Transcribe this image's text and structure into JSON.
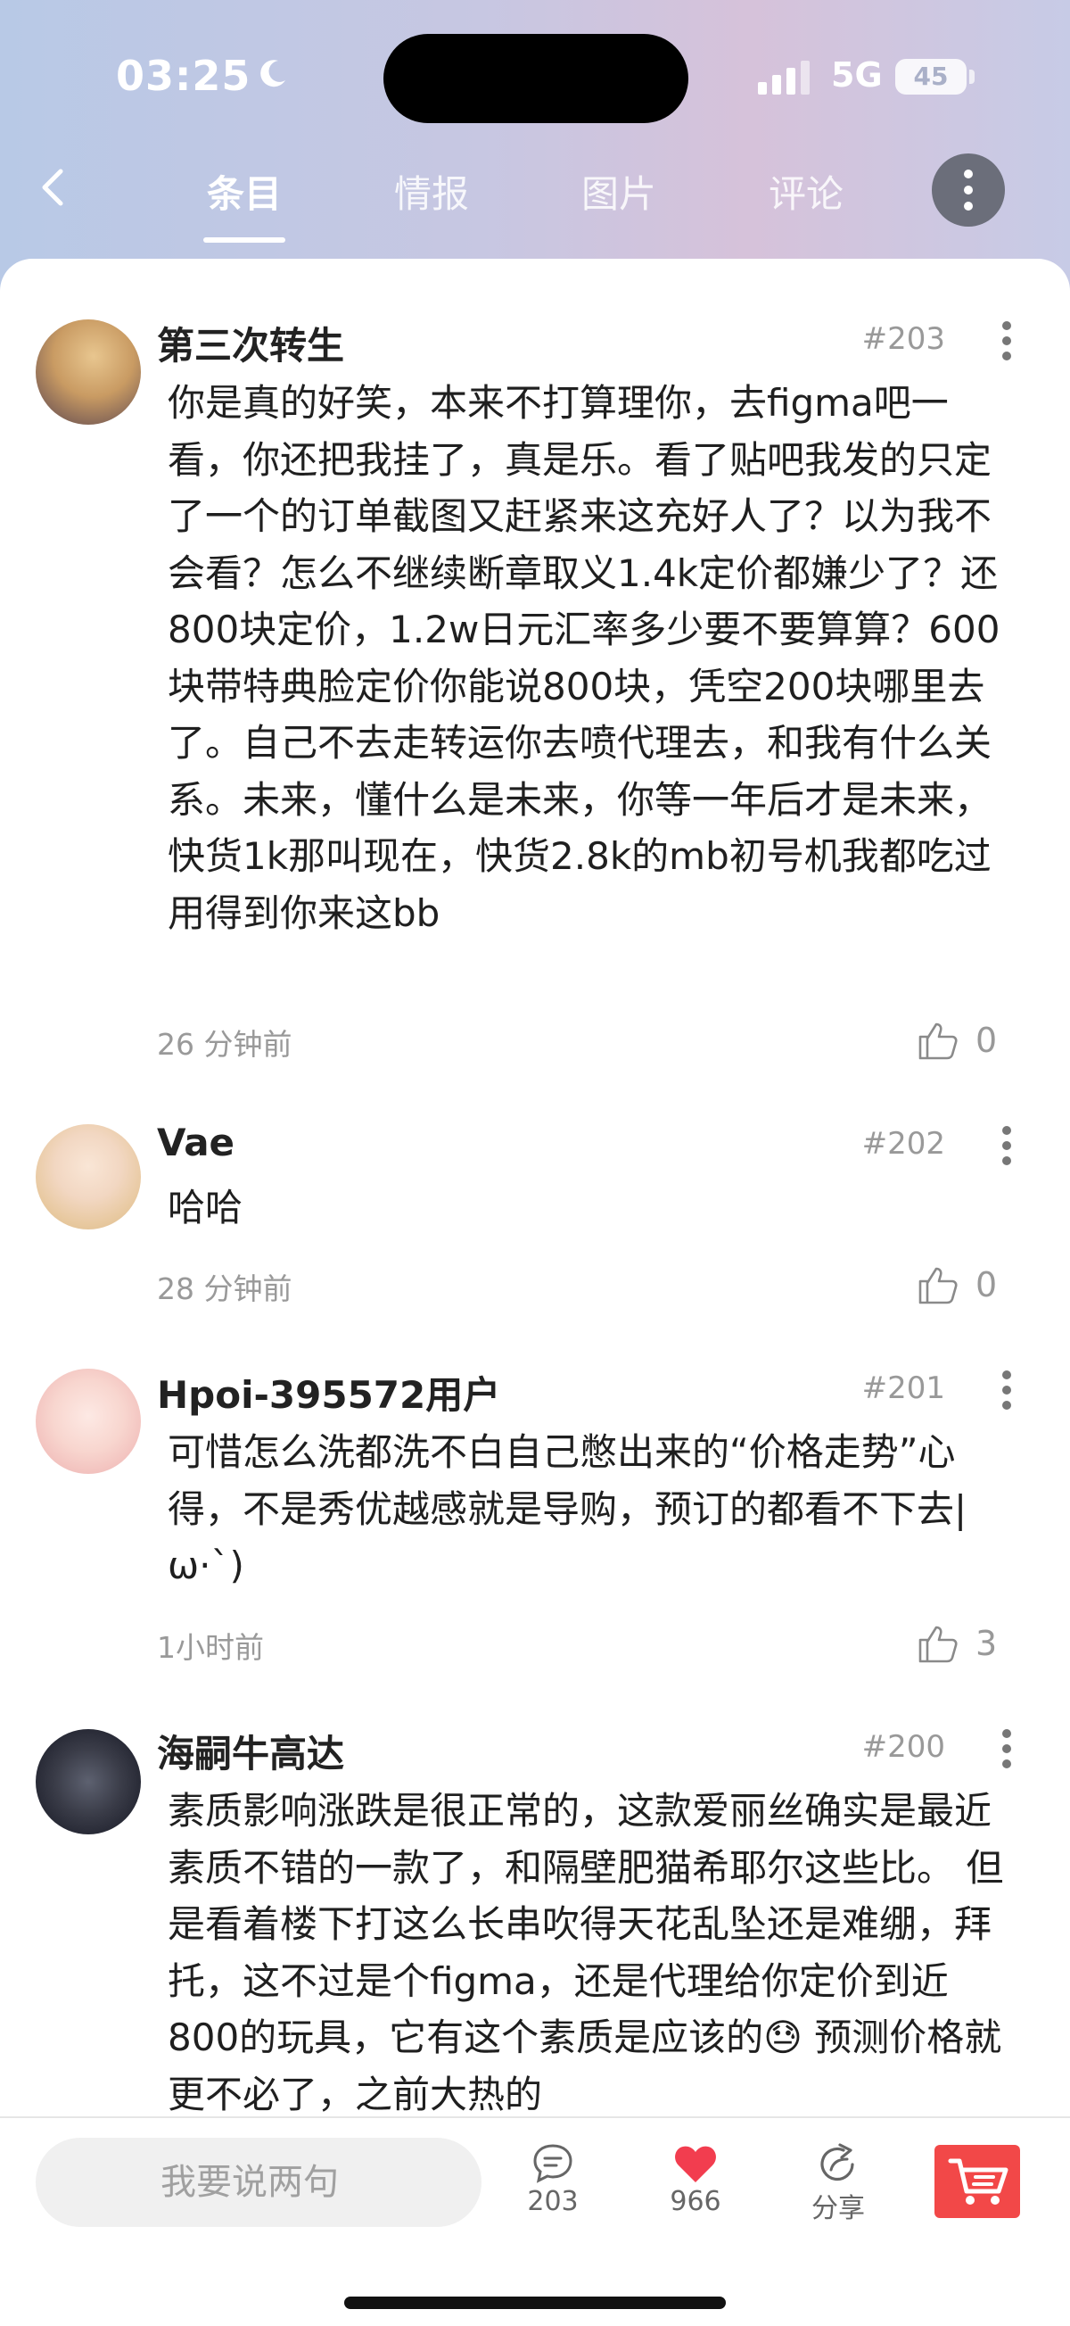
{
  "status": {
    "time": "03:25",
    "network": "5G",
    "battery": "45"
  },
  "nav": {
    "tabs": [
      {
        "label": "条目"
      },
      {
        "label": "情报"
      },
      {
        "label": "图片"
      },
      {
        "label": "评论"
      }
    ],
    "active_tab": "条目"
  },
  "comments": [
    {
      "user": "第三次转生",
      "floor": "#203",
      "text": "你是真的好笑，本来不打算理你，去figma吧一看，你还把我挂了，真是乐。看了贴吧我发的只定了一个的订单截图又赶紧来这充好人了？以为我不会看？怎么不继续断章取义1.4k定价都嫌少了？还800块定价，1.2w日元汇率多少要不要算算？600块带特典脸定价你能说800块，凭空200块哪里去了。自己不去走转运你去喷代理去，和我有什么关系。未来，懂什么是未来，你等一年后才是未来，快货1k那叫现在，快货2.8k的mb初号机我都吃过用得到你来这bb",
      "time": "26 分钟前",
      "likes": "0"
    },
    {
      "user": "Vae",
      "floor": "#202",
      "text": "哈哈",
      "time": "28 分钟前",
      "likes": "0"
    },
    {
      "user": "Hpoi-395572用户",
      "floor": "#201",
      "text": "可惜怎么洗都洗不白自己憋出来的“价格走势”心得，不是秀优越感就是导购，预订的都看不下去|ω·`)",
      "time": "1小时前",
      "likes": "3"
    },
    {
      "user": "海嗣牛高达",
      "floor": "#200",
      "text": "素质影响涨跌是很正常的，这款爱丽丝确实是最近素质不错的一款了，和隔壁肥猫希耶尔这些比。 但是看着楼下打这么长串吹得天花乱坠还是难绷，拜托，这不过是个figma，还是代理给你定价到近800的玩具，它有这个素质是应该的😓 预测价格就更不必了，之前大热的",
      "time": "",
      "likes": ""
    }
  ],
  "bottom": {
    "input_placeholder": "我要说两句",
    "comment_count": "203",
    "like_count": "966",
    "share_label": "分享"
  },
  "colors": {
    "heart": "#f23d4f",
    "cart": "#f24848",
    "gradient": [
      "#b8c9e6",
      "#d6c2da"
    ]
  }
}
